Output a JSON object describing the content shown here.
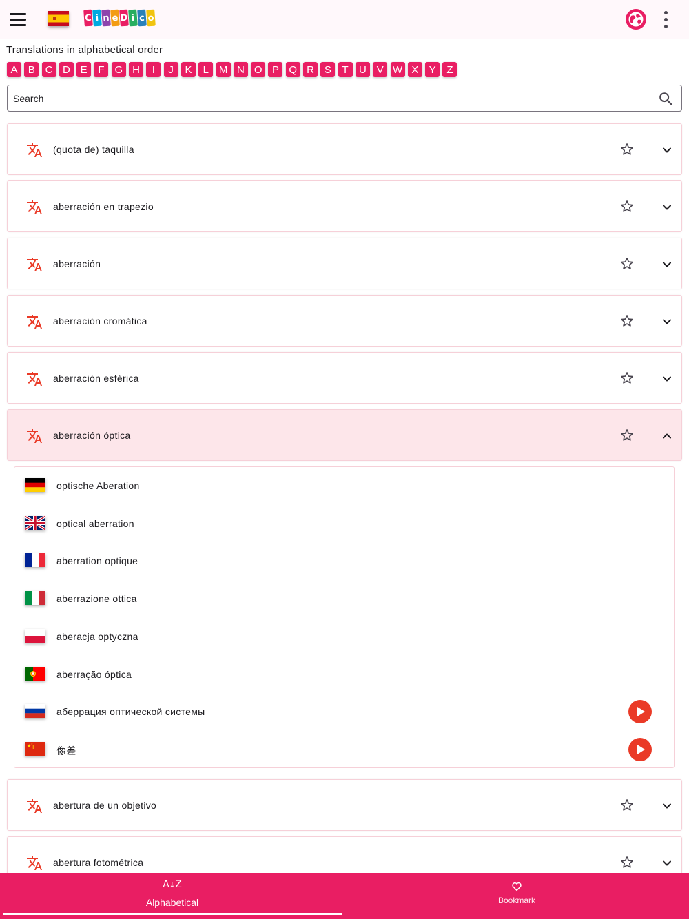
{
  "app": {
    "logo_text": "CineDico",
    "logo_letters": [
      {
        "ch": "C",
        "color": "#e91e63"
      },
      {
        "ch": "i",
        "color": "#00a9e0"
      },
      {
        "ch": "n",
        "color": "#8e44ad"
      },
      {
        "ch": "e",
        "color": "#f39c12"
      },
      {
        "ch": "D",
        "color": "#e91e63"
      },
      {
        "ch": "i",
        "color": "#27ae60"
      },
      {
        "ch": "c",
        "color": "#2980b9"
      },
      {
        "ch": "o",
        "color": "#f1c40f"
      }
    ],
    "source_language_flag": "spain-flag",
    "accent_color": "#e91e63"
  },
  "header": {
    "title": "Translations in alphabetical order",
    "letters": [
      "A",
      "B",
      "C",
      "D",
      "E",
      "F",
      "G",
      "H",
      "I",
      "J",
      "K",
      "L",
      "M",
      "N",
      "O",
      "P",
      "Q",
      "R",
      "S",
      "T",
      "U",
      "V",
      "W",
      "X",
      "Y",
      "Z"
    ]
  },
  "search": {
    "placeholder": "Search",
    "value": ""
  },
  "terms": [
    {
      "label": "(quota de) taquilla",
      "expanded": false
    },
    {
      "label": "aberración en trapezio",
      "expanded": false
    },
    {
      "label": "aberración",
      "expanded": false
    },
    {
      "label": "aberración cromática",
      "expanded": false
    },
    {
      "label": "aberración esférica",
      "expanded": false
    },
    {
      "label": "aberración óptica",
      "expanded": true,
      "translations": [
        {
          "flag": "germany-flag",
          "text": "optische Aberation",
          "audio": false
        },
        {
          "flag": "uk-flag",
          "text": "optical aberration",
          "audio": false
        },
        {
          "flag": "france-flag",
          "text": "aberration optique",
          "audio": false
        },
        {
          "flag": "italy-flag",
          "text": "aberrazione ottica",
          "audio": false
        },
        {
          "flag": "poland-flag",
          "text": "aberacja optyczna",
          "audio": false
        },
        {
          "flag": "portugal-flag",
          "text": "aberração óptica",
          "audio": false
        },
        {
          "flag": "russia-flag",
          "text": "аберрация оптической системы",
          "audio": true
        },
        {
          "flag": "china-flag",
          "text": "像差",
          "audio": true
        }
      ]
    },
    {
      "label": "abertura de un objetivo",
      "expanded": false
    },
    {
      "label": "abertura fotométrica",
      "expanded": false
    }
  ],
  "bottom_nav": {
    "alphabetical_label": "Alphabetical",
    "alphabetical_icon": "A→Z",
    "bookmark_label": "Bookmark",
    "active": "alphabetical"
  }
}
